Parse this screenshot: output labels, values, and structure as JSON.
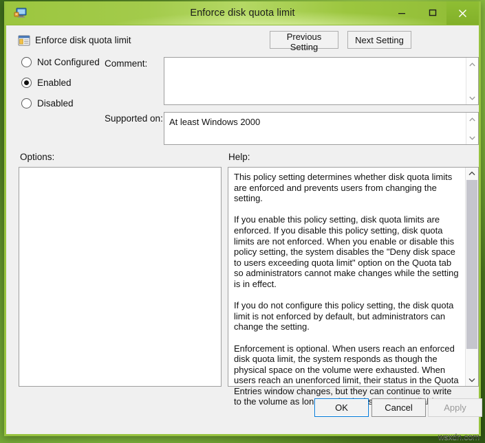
{
  "window": {
    "title": "Enforce disk quota limit",
    "app_icon": "computer-policy-icon",
    "minimize_label": "–",
    "maximize_label": "❐",
    "close_label": "×"
  },
  "header": {
    "policy_icon": "policy-setting-icon",
    "policy_title": "Enforce disk quota limit",
    "previous_button": "Previous Setting",
    "next_button": "Next Setting"
  },
  "state": {
    "options": [
      {
        "label": "Not Configured",
        "selected": false
      },
      {
        "label": "Enabled",
        "selected": true
      },
      {
        "label": "Disabled",
        "selected": false
      }
    ],
    "comment_label": "Comment:",
    "comment_value": "",
    "supported_label": "Supported on:",
    "supported_value": "At least Windows 2000"
  },
  "panels": {
    "options_label": "Options:",
    "options_content": "",
    "help_label": "Help:",
    "help_text": "This policy setting determines whether disk quota limits are enforced and prevents users from changing the setting.\n\nIf you enable this policy setting, disk quota limits are enforced. If you disable this policy setting, disk quota limits are not enforced. When you enable or disable this policy setting, the system disables the \"Deny disk space to users exceeding quota limit\" option on the Quota tab so administrators cannot make changes while the setting is in effect.\n\nIf you do not configure this policy setting, the disk quota limit is not enforced by default, but administrators can change the setting.\n\nEnforcement is optional. When users reach an enforced disk quota limit, the system responds as though the physical space on the volume were exhausted. When users reach an unenforced limit, their status in the Quota Entries window changes, but they can continue to write to the volume as long as physical space is available."
  },
  "footer": {
    "ok_label": "OK",
    "cancel_label": "Cancel",
    "apply_label": "Apply",
    "apply_enabled": false
  },
  "watermark": "wsxdn.com",
  "colors": {
    "title_green": "#9cc63f",
    "border_green": "#97c33f",
    "dialog_face": "#f0f0f0",
    "focus_blue": "#0078d7",
    "disabled_text": "#9a9a9a"
  }
}
